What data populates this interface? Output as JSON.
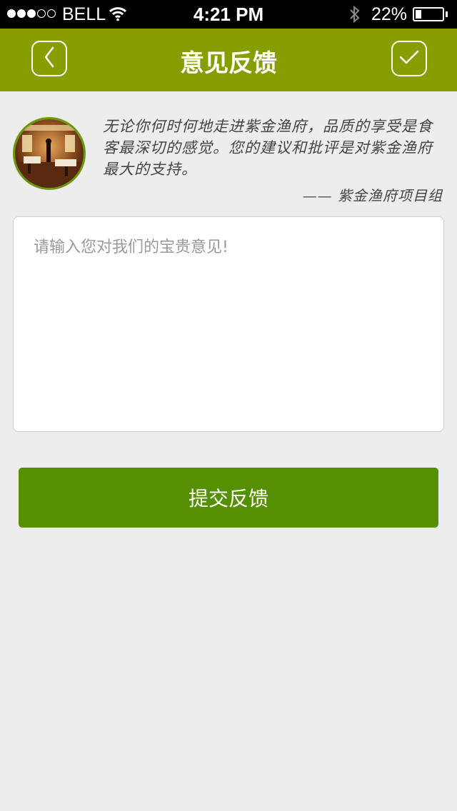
{
  "status_bar": {
    "carrier": "BELL",
    "time": "4:21 PM",
    "battery_percent": "22%",
    "battery_level": 0.22,
    "signal_bars": 3,
    "signal_total": 5,
    "icons": [
      "wifi-icon",
      "bluetooth-icon",
      "battery-icon"
    ]
  },
  "nav": {
    "title": "意见反馈",
    "back_icon": "chevron-left-icon",
    "confirm_icon": "checkmark-icon",
    "color": "#879d00"
  },
  "intro": {
    "text": "无论你何时何地走进紫金渔府，品质的享受是食客最深切的感觉。您的建议和批评是对紫金渔府最大的支持。",
    "signature": "——  紫金渔府项目组"
  },
  "feedback": {
    "placeholder": "请输入您对我们的宝贵意见!",
    "value": ""
  },
  "submit": {
    "label": "提交反馈",
    "color": "#558f02"
  }
}
